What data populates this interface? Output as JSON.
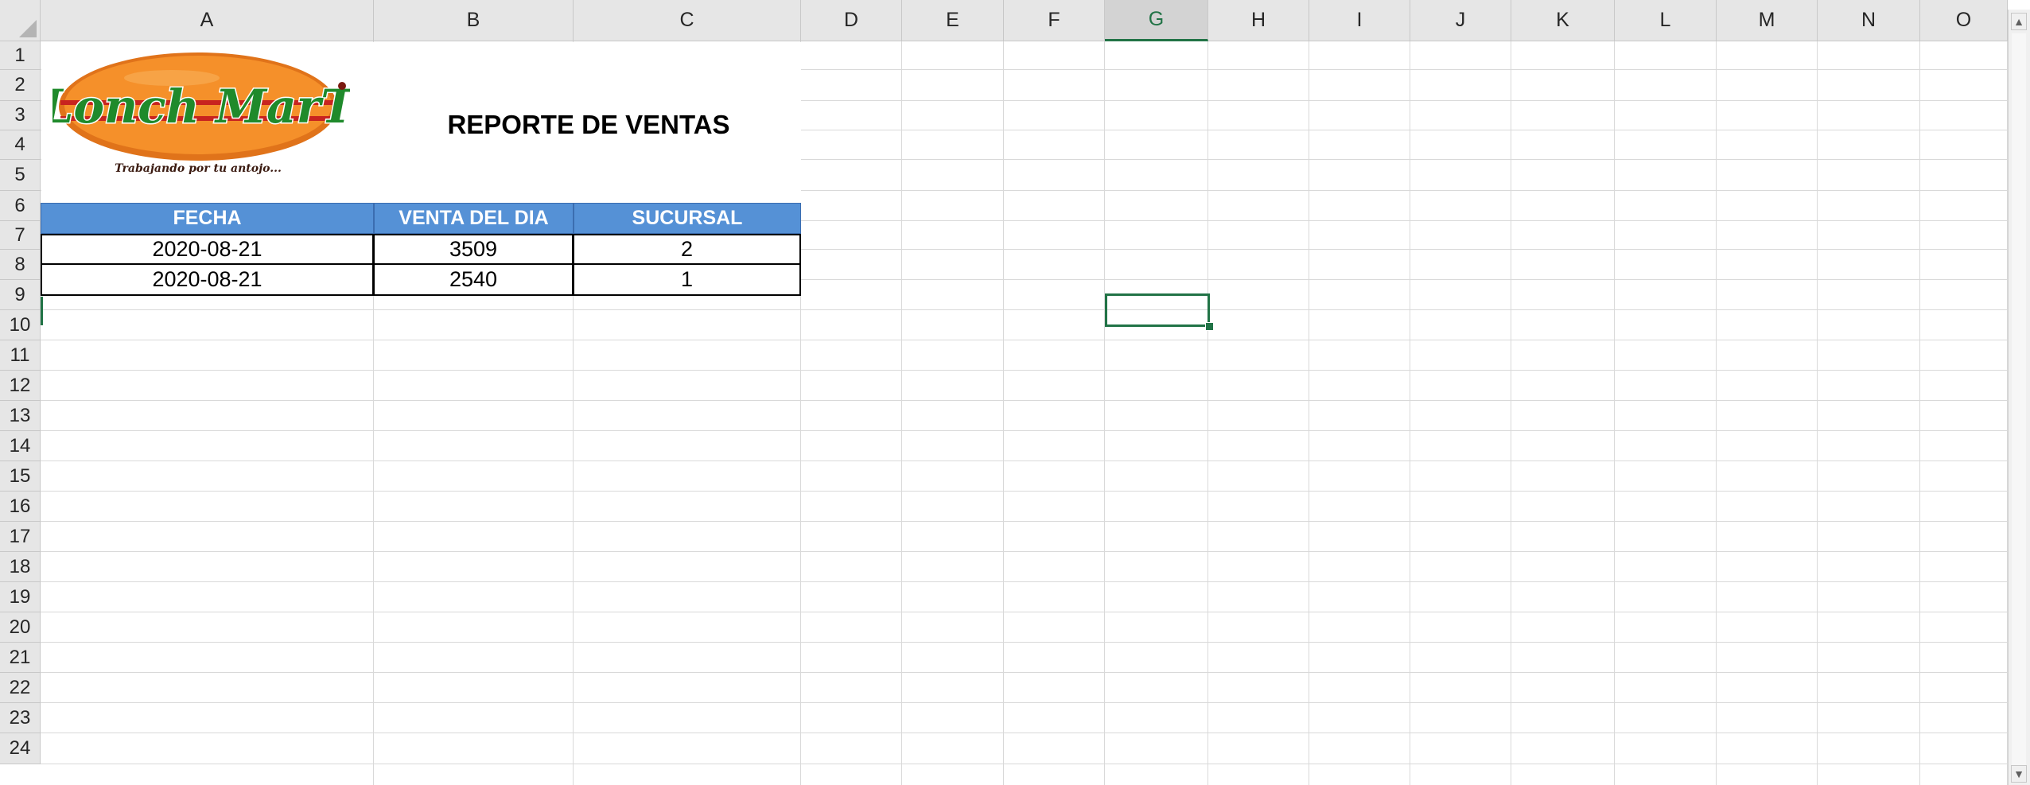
{
  "columns": [
    "A",
    "B",
    "C",
    "D",
    "E",
    "F",
    "G",
    "H",
    "I",
    "J",
    "K",
    "L",
    "M",
    "N",
    "O"
  ],
  "rows": [
    "1",
    "2",
    "3",
    "4",
    "5",
    "6",
    "7",
    "8",
    "9",
    "10",
    "11",
    "12",
    "13",
    "14",
    "15",
    "16",
    "17",
    "18",
    "19",
    "20",
    "21",
    "22",
    "23",
    "24"
  ],
  "active_column": "G",
  "active_cell": "G9",
  "logo": {
    "brand_text": "Lonch MarT",
    "tagline": "Trabajando por tu antojo..."
  },
  "report_title": "REPORTE DE VENTAS",
  "table": {
    "headers": [
      "FECHA",
      "VENTA DEL DIA",
      "SUCURSAL"
    ],
    "rows": [
      [
        "2020-08-21",
        "3509",
        "2"
      ],
      [
        "2020-08-21",
        "2540",
        "1"
      ]
    ]
  },
  "colors": {
    "header_fill": "#5591d6",
    "selection": "#217346",
    "logo_orange": "#f08a1c",
    "logo_green": "#1f8a2b"
  },
  "scrollbar": {
    "up_icon": "▲",
    "down_icon": "▼"
  }
}
